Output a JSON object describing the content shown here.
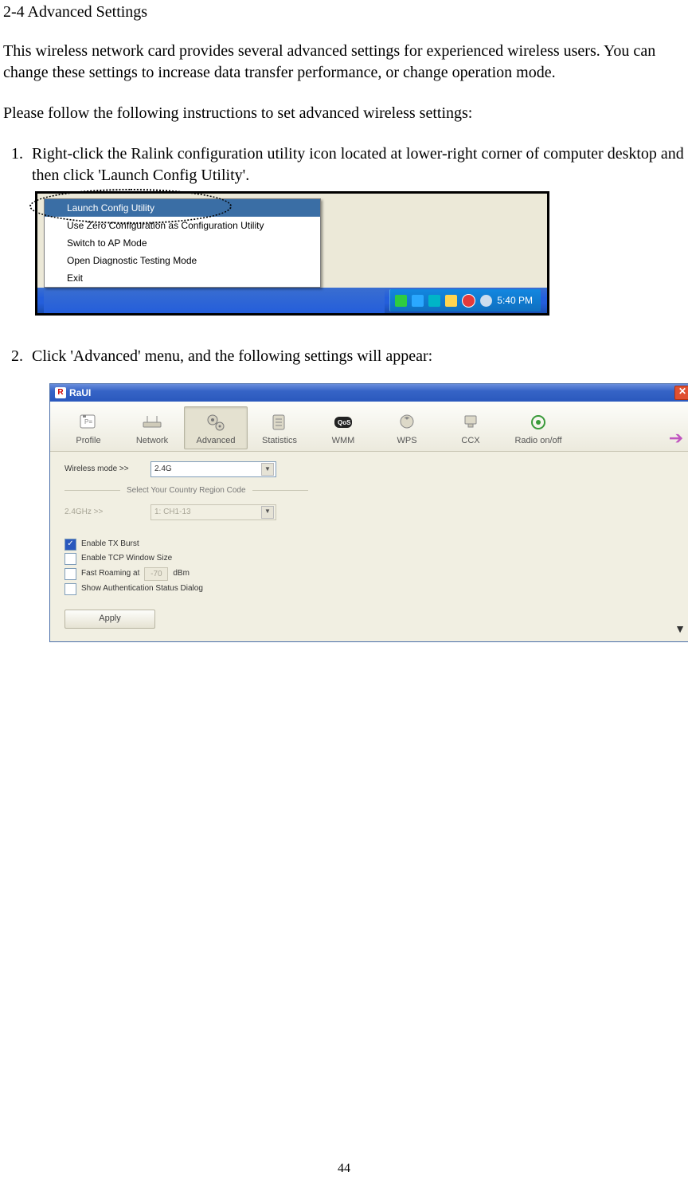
{
  "section_title": "2-4 Advanced Settings",
  "para1": "This wireless network card provides several advanced settings for experienced wireless users. You can change these settings to increase data transfer performance, or change operation mode.",
  "para2": "Please follow the following instructions to set advanced wireless settings:",
  "step1": "Right-click the Ralink configuration utility icon located at lower-right corner of computer desktop and then click 'Launch Config Utility'.",
  "step2": "Click 'Advanced' menu, and the following settings will appear:",
  "ctx_menu": {
    "items": [
      "Launch Config Utility",
      "Use Zero Configuration as Configuration Utility",
      "Switch to AP Mode",
      "Open Diagnostic Testing Mode",
      "Exit"
    ]
  },
  "taskbar_time": "5:40 PM",
  "raui": {
    "title": "RaUI",
    "tabs": [
      "Profile",
      "Network",
      "Advanced",
      "Statistics",
      "WMM",
      "WPS",
      "CCX",
      "Radio on/off"
    ],
    "active_tab_index": 2,
    "wireless_mode_label": "Wireless mode >>",
    "wireless_mode_value": "2.4G",
    "fieldset_label": "Select Your Country Region Code",
    "country_label": "2.4GHz >>",
    "country_value": "1: CH1-13",
    "checkboxes": [
      {
        "label": "Enable TX Burst",
        "checked": true
      },
      {
        "label": "Enable TCP Window Size",
        "checked": false
      },
      {
        "label_pre": "Fast Roaming at",
        "value": "-70",
        "label_post": "dBm",
        "checked": false,
        "roam": true
      },
      {
        "label": "Show Authentication Status Dialog",
        "checked": false
      }
    ],
    "apply_label": "Apply"
  },
  "page_number": "44"
}
